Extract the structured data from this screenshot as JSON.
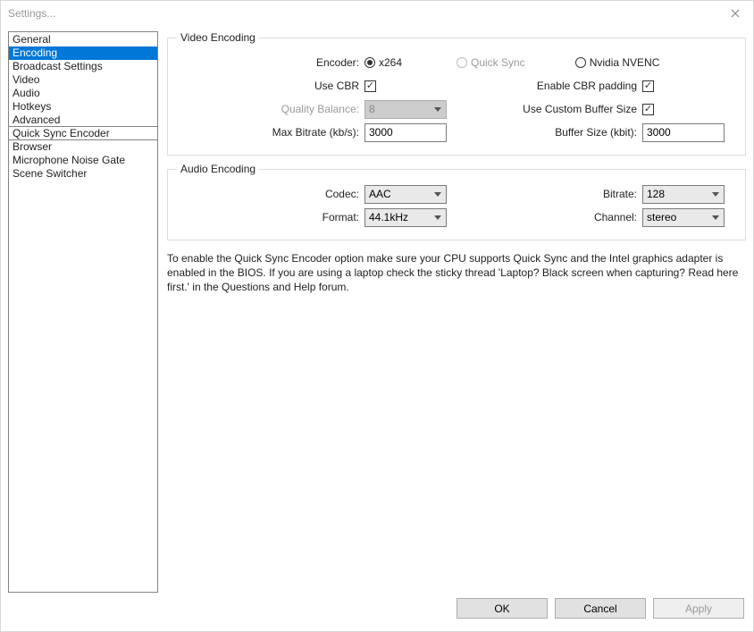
{
  "window": {
    "title": "Settings..."
  },
  "sidebar": {
    "items": [
      {
        "label": "General"
      },
      {
        "label": "Encoding",
        "selected": true
      },
      {
        "label": "Broadcast Settings"
      },
      {
        "label": "Video"
      },
      {
        "label": "Audio"
      },
      {
        "label": "Hotkeys"
      },
      {
        "label": "Advanced",
        "separator_after": true
      },
      {
        "label": "Quick Sync Encoder",
        "separator_after": true
      },
      {
        "label": "Browser"
      },
      {
        "label": "Microphone Noise Gate"
      },
      {
        "label": "Scene Switcher"
      }
    ]
  },
  "video_encoding": {
    "legend": "Video Encoding",
    "encoder_label": "Encoder:",
    "encoders": {
      "x264": "x264",
      "quicksync": "Quick Sync",
      "nvenc": "Nvidia NVENC"
    },
    "encoder_selected": "x264",
    "use_cbr_label": "Use CBR",
    "use_cbr": true,
    "enable_cbr_padding_label": "Enable CBR padding",
    "enable_cbr_padding": true,
    "quality_balance_label": "Quality Balance:",
    "quality_balance": "8",
    "use_custom_buffer_label": "Use Custom Buffer Size",
    "use_custom_buffer": true,
    "max_bitrate_label": "Max Bitrate (kb/s):",
    "max_bitrate": "3000",
    "buffer_size_label": "Buffer Size (kbit):",
    "buffer_size": "3000"
  },
  "audio_encoding": {
    "legend": "Audio Encoding",
    "codec_label": "Codec:",
    "codec": "AAC",
    "bitrate_label": "Bitrate:",
    "bitrate": "128",
    "format_label": "Format:",
    "format": "44.1kHz",
    "channel_label": "Channel:",
    "channel": "stereo"
  },
  "info_text": "To enable the Quick Sync Encoder option make sure your CPU supports Quick Sync and the Intel graphics adapter is enabled in the BIOS. If you are using a laptop check the sticky thread 'Laptop? Black screen when capturing? Read here first.' in the Questions and Help forum.",
  "buttons": {
    "ok": "OK",
    "cancel": "Cancel",
    "apply": "Apply"
  }
}
